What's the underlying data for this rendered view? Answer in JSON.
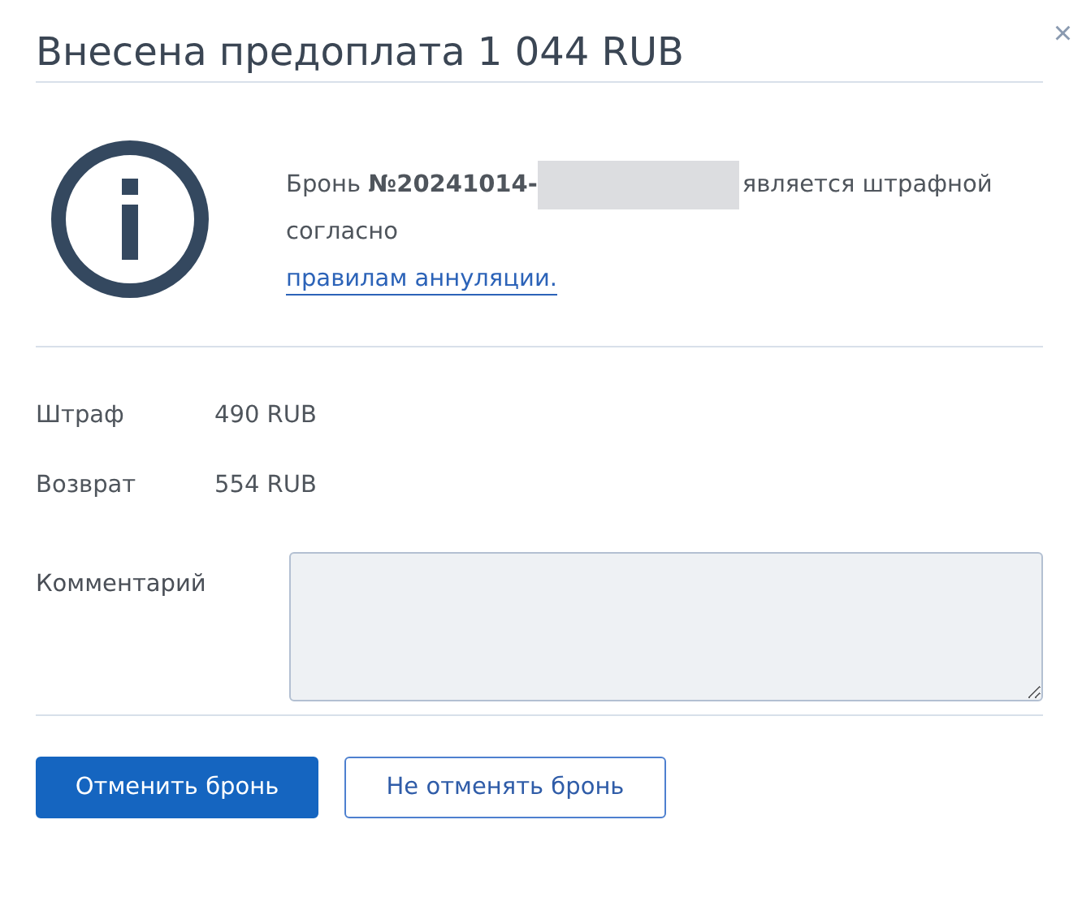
{
  "dialog": {
    "title": "Внесена предоплата 1 044 RUB",
    "close": "×"
  },
  "message": {
    "before": "Бронь **№20241014-**",
    "redacted": true,
    "after": "является штрафной согласно",
    "link": "правилам аннуляции."
  },
  "details": [
    {
      "label": "Штраф",
      "value": "490 RUB"
    },
    {
      "label": "Возврат",
      "value": "554 RUB"
    }
  ],
  "comment": {
    "label": "Комментарий"
  },
  "buttons": [
    {
      "label": "Отменить бронь",
      "kind": "primary"
    },
    {
      "label": "Не отменять бронь",
      "kind": "secondary"
    }
  ]
}
